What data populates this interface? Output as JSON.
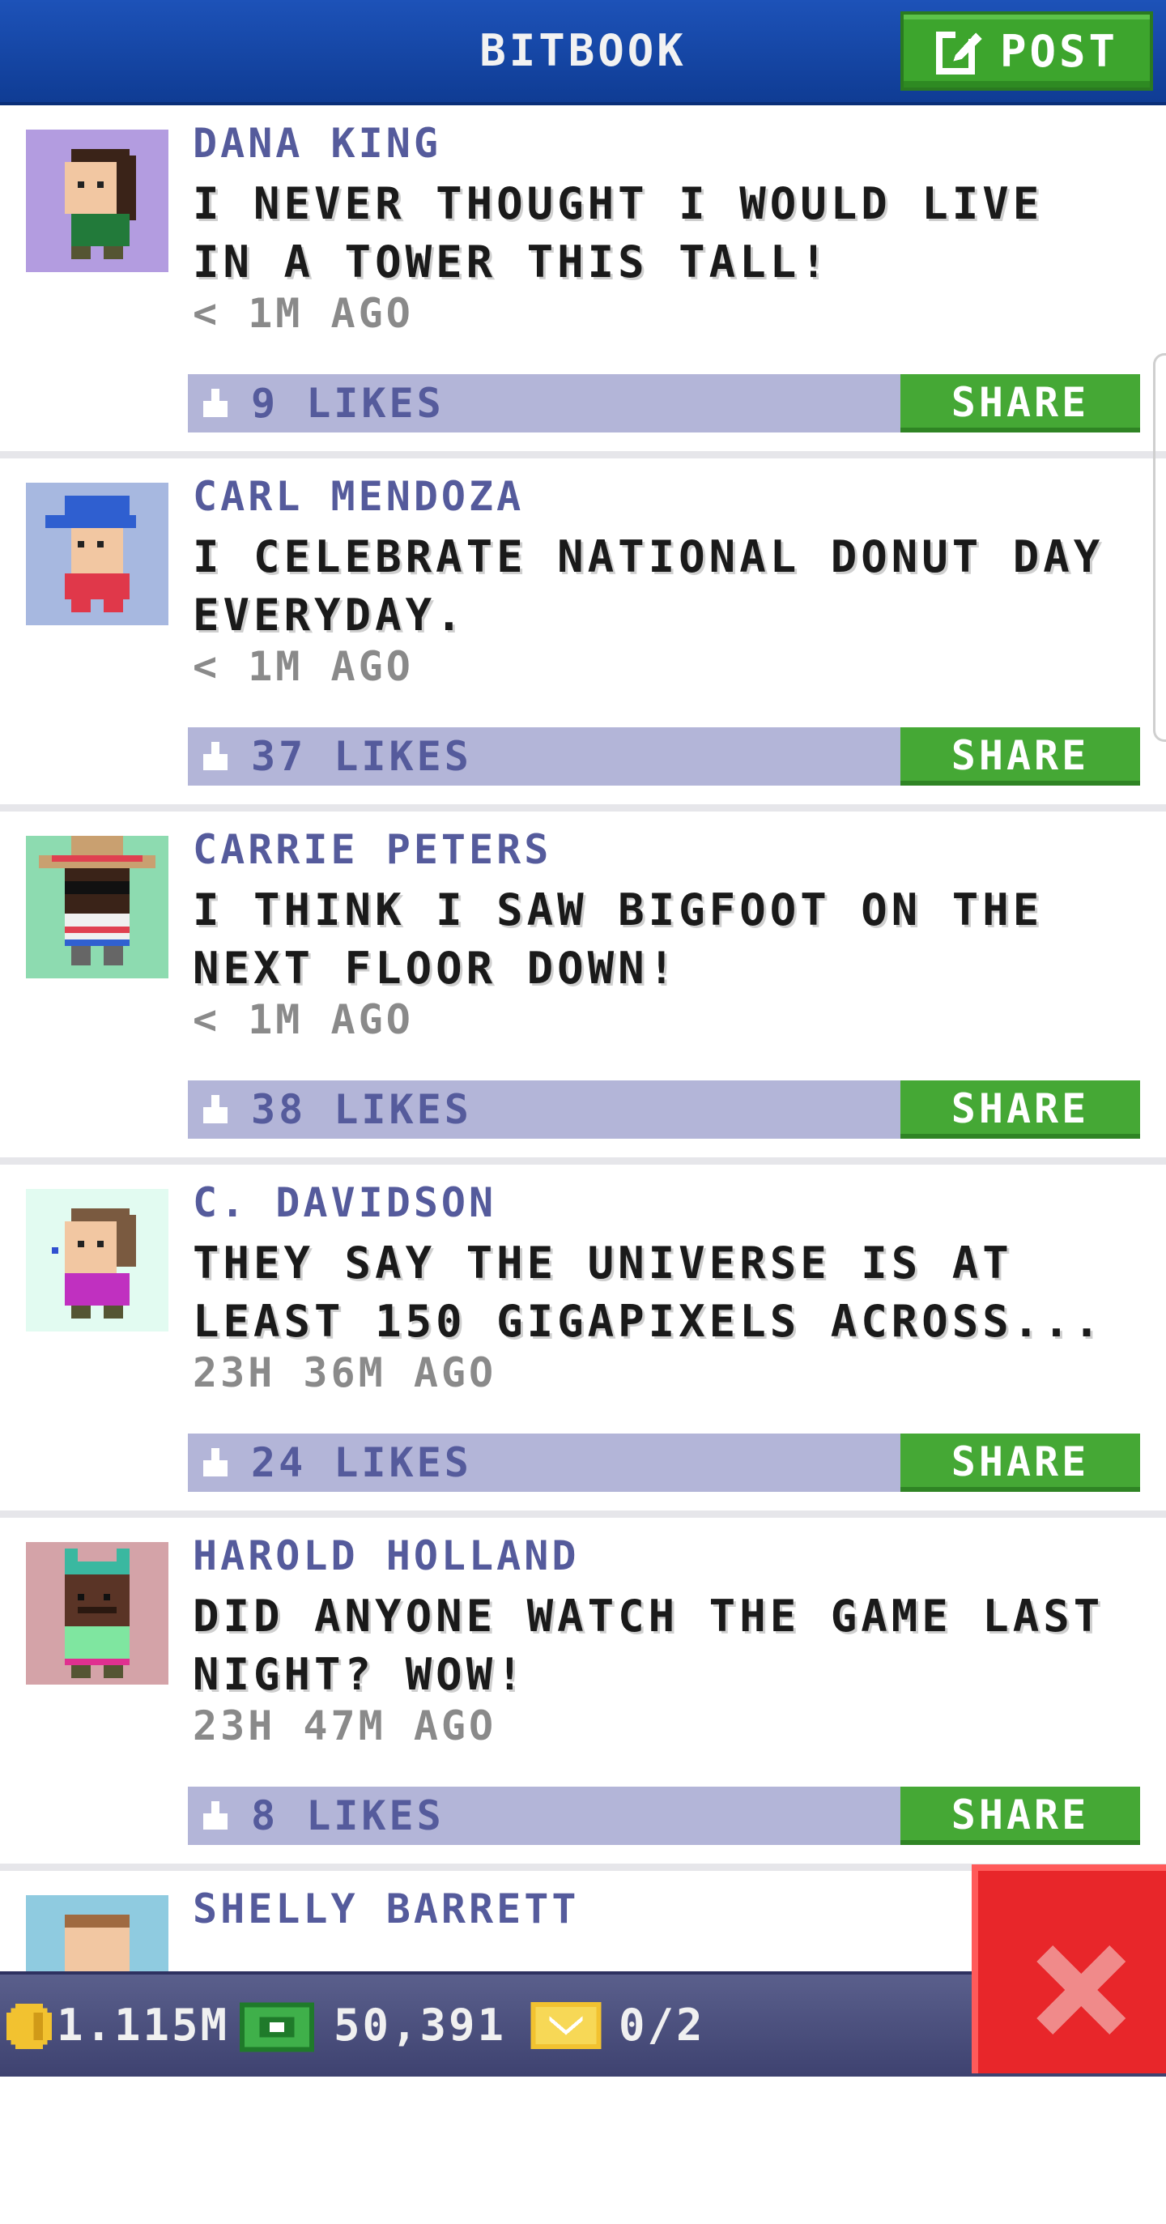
{
  "header": {
    "title": "BITBOOK",
    "post_label": "POST"
  },
  "share_label": "SHARE",
  "posts": [
    {
      "author": "DANA KING",
      "message": "I NEVER THOUGHT I WOULD LIVE IN A TOWER THIS TALL!",
      "timestamp": "< 1M AGO",
      "likes": "9 LIKES",
      "avatar_bg": "#b39ce0"
    },
    {
      "author": "CARL MENDOZA",
      "message": "I CELEBRATE NATIONAL DONUT DAY EVERYDAY.",
      "timestamp": "< 1M AGO",
      "likes": "37 LIKES",
      "avatar_bg": "#a7b8e0"
    },
    {
      "author": "CARRIE PETERS",
      "message": "I THINK I SAW BIGFOOT ON THE NEXT FLOOR DOWN!",
      "timestamp": "< 1M AGO",
      "likes": "38 LIKES",
      "avatar_bg": "#8ddbb0"
    },
    {
      "author": "C. DAVIDSON",
      "message": "THEY SAY THE UNIVERSE IS AT LEAST 150 GIGAPIXELS ACROSS...",
      "timestamp": "23H 36M AGO",
      "likes": "24 LIKES",
      "avatar_bg": "#e2fbf1"
    },
    {
      "author": "HAROLD HOLLAND",
      "message": "DID ANYONE WATCH THE GAME LAST NIGHT? WOW!",
      "timestamp": "23H 47M AGO",
      "likes": "8 LIKES",
      "avatar_bg": "#d4a3a8"
    },
    {
      "author": "SHELLY BARRETT",
      "message": "",
      "timestamp": "",
      "likes": "",
      "avatar_bg": "#8fcbe0"
    }
  ],
  "bottom_bar": {
    "coins": "1.115M",
    "cash": "50,391",
    "tickets": "0/2"
  },
  "icons": {
    "post": "edit-icon",
    "like": "thumbs-up-icon",
    "coin": "coin-icon",
    "cash": "cash-icon",
    "ticket": "ticket-icon",
    "close": "close-icon"
  },
  "colors": {
    "header": "#1d52b8",
    "green": "#45a835",
    "likes_bar": "#b3b5d8",
    "author": "#555b9c",
    "close": "#e8262a"
  }
}
